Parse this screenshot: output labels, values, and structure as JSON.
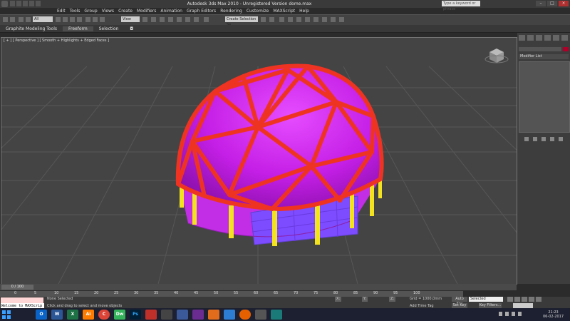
{
  "window": {
    "title": "Autodesk 3ds Max 2010  -  Unregistered Version    dome.max",
    "search_placeholder": "Type a keyword or phrase"
  },
  "menu": [
    "Edit",
    "Tools",
    "Group",
    "Views",
    "Create",
    "Modifiers",
    "Animation",
    "Graph Editors",
    "Rendering",
    "Customize",
    "MAXScript",
    "Help"
  ],
  "toolbar": {
    "selection_filter": "All",
    "reference_coord": "View",
    "named_selection": "Create Selection Se"
  },
  "ribbon": {
    "tabs": [
      "Graphite Modeling Tools",
      "Freeform",
      "Selection"
    ],
    "active_tab": "Freeform"
  },
  "viewport": {
    "label": "[ + ] [ Perspective ] [ Smooth + Highlights + Edged Faces ]"
  },
  "command_panel": {
    "modifier_list": "Modifier List"
  },
  "time_slider": {
    "value": "0 / 100"
  },
  "trackbar_ticks": [
    "0",
    "5",
    "10",
    "15",
    "20",
    "25",
    "30",
    "35",
    "40",
    "45",
    "50",
    "55",
    "60",
    "65",
    "70",
    "75",
    "80",
    "85",
    "90",
    "95",
    "100"
  ],
  "status": {
    "maxscript_welcome": "Welcome to MAXScrip",
    "selection_status": "None Selected",
    "prompt": "Click and drag to select and move objects",
    "x_label": "X:",
    "y_label": "Y:",
    "z_label": "Z:",
    "grid": "Grid = 1000,0mm",
    "add_time_tag": "Add Time Tag",
    "auto_key": "Auto Key",
    "set_key": "Set Key",
    "selected_dropdown": "Selected",
    "key_filters": "Key Filters..."
  },
  "taskbar": {
    "apps": [
      "O",
      "W",
      "X",
      "Ai",
      "C",
      "Dw",
      "Ps",
      "",
      "",
      "",
      "",
      "",
      "",
      "",
      "",
      ""
    ],
    "time": "21:23",
    "date": "06-02-2017"
  },
  "colors": {
    "dome_fill": "#cc22ee",
    "dome_struts": "#ee3322",
    "columns": "#f2e220",
    "window_band": "#8a3cff"
  }
}
